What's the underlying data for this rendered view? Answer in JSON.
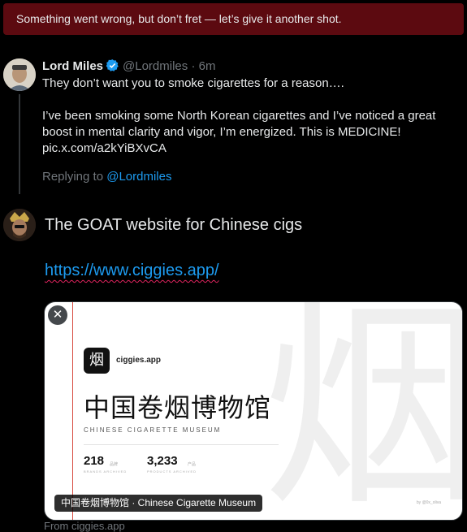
{
  "error_banner": {
    "message": "Something went wrong, but don’t fret — let’s give it another shot."
  },
  "quoted_post": {
    "author_name": "Lord Miles",
    "handle": "@Lordmiles",
    "separator": "·",
    "time": "6m",
    "line1": "They don’t want you to smoke cigarettes for a reason….",
    "line2": "I’ve been smoking some North Korean cigarettes and I’ve noticed a great",
    "line3": "boost in mental clarity and vigor, I’m energized. This is MEDICINE!",
    "line4": "pic.x.com/a2kYiBXvCA",
    "replying_prefix": "Replying to",
    "replying_handle": "@Lordmiles"
  },
  "compose": {
    "text": "The GOAT website for Chinese cigs",
    "url": "https://www.ciggies.app/"
  },
  "link_card": {
    "close_symbol": "✕",
    "logo_char": "烟",
    "site_name": "ciggies.app",
    "title": "中国卷烟博物馆",
    "subtitle": "CHINESE CIGARETTE MUSEUM",
    "stat1_value": "218",
    "stat1_unit": "品牌",
    "stat1_label": "BRANDS ARCHIVED",
    "stat2_value": "3,233",
    "stat2_unit": "产品",
    "stat2_label": "PRODUCTS ARCHIVED",
    "watermark_char": "烟",
    "credit": "by @0x_oliva",
    "caption": "中国卷烟博物馆 · Chinese Cigarette Museum",
    "from_text": "From ciggies.app"
  },
  "colors": {
    "accent": "#1d9bf0",
    "error_bg": "#5c0a10",
    "muted": "#71767b"
  }
}
